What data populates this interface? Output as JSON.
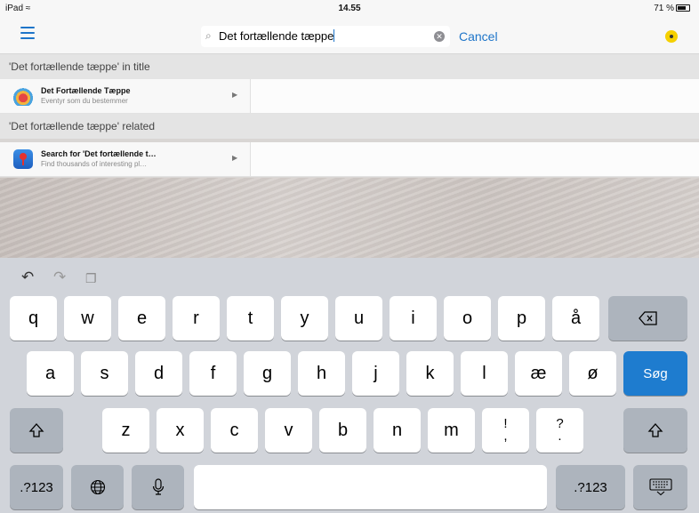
{
  "status_bar": {
    "device": "iPad",
    "time": "14.55",
    "battery": "71 %"
  },
  "nav": {
    "search_value": "Det fortællende tæppe",
    "cancel_label": "Cancel"
  },
  "sections": {
    "title_header": "'Det fortællende tæppe' in title",
    "related_header": "'Det fortællende tæppe' related"
  },
  "results": {
    "title_result": {
      "title": "Det Fortællende Tæppe",
      "subtitle": "Eventyr som du bestemmer"
    },
    "related_result": {
      "title": "Search for 'Det fortællende t…",
      "subtitle": "Find thousands of interesting pl…"
    }
  },
  "keyboard": {
    "row1": [
      "q",
      "w",
      "e",
      "r",
      "t",
      "y",
      "u",
      "i",
      "o",
      "p",
      "å"
    ],
    "row2": [
      "a",
      "s",
      "d",
      "f",
      "g",
      "h",
      "j",
      "k",
      "l",
      "æ",
      "ø"
    ],
    "row3": [
      "z",
      "x",
      "c",
      "v",
      "b",
      "n",
      "m",
      "!\n,",
      "?\n."
    ],
    "search_key": "Søg",
    "numbers_left": ".?123",
    "numbers_right": ".?123"
  },
  "icons": {
    "menu": "hamburger-icon",
    "search": "magnifier-icon",
    "clear": "clear-icon",
    "app": "yellow-circle-app-icon",
    "backspace": "backspace-icon",
    "shift": "shift-icon",
    "globe": "globe-icon",
    "mic": "microphone-icon",
    "hide": "keyboard-hide-icon"
  },
  "colors": {
    "accent": "#1e75c9",
    "search_key": "#1e7ccf"
  }
}
